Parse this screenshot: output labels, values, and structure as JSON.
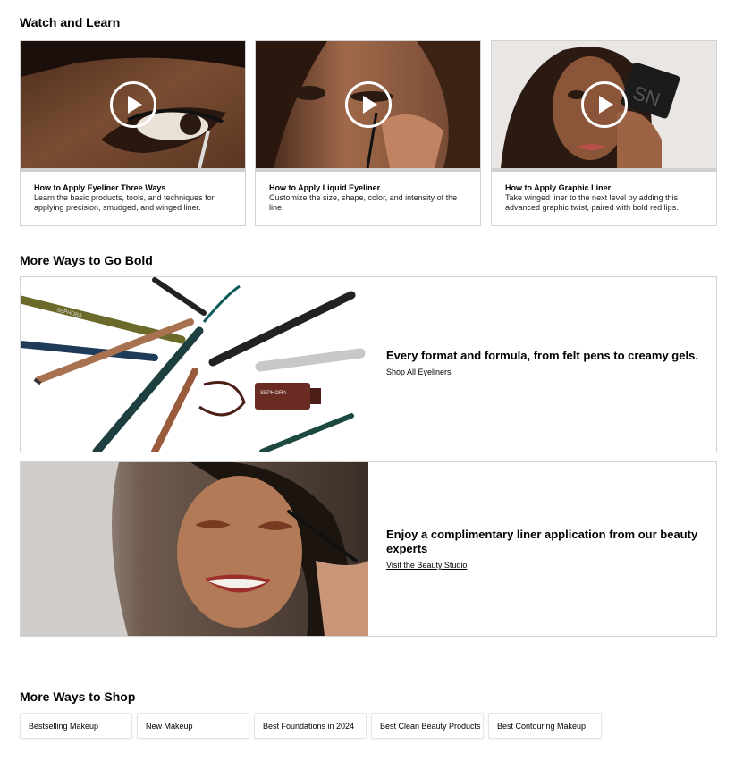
{
  "watch_learn": {
    "title": "Watch and Learn",
    "videos": [
      {
        "title": "How to Apply Eyeliner Three Ways",
        "description": "Learn the basic products, tools, and techniques for applying precision, smudged, and winged liner."
      },
      {
        "title": "How to Apply Liquid Eyeliner",
        "description": "Customize the size, shape, color, and intensity of the line."
      },
      {
        "title": "How to Apply Graphic Liner",
        "description": "Take winged liner to the next level by adding this advanced graphic twist, paired with bold red lips."
      }
    ]
  },
  "go_bold": {
    "title": "More Ways to Go Bold",
    "banners": [
      {
        "headline": "Every format and formula, from felt pens to creamy gels.",
        "link": "Shop All Eyeliners",
        "product_brand": "SEPHORA"
      },
      {
        "headline": "Enjoy a complimentary liner application from our beauty experts",
        "link": "Visit the Beauty Studio"
      }
    ]
  },
  "shop": {
    "title": "More Ways to Shop",
    "chips": [
      "Bestselling Makeup",
      "New Makeup",
      "Best Foundations in 2024",
      "Best Clean Beauty Products",
      "Best Contouring Makeup"
    ]
  }
}
